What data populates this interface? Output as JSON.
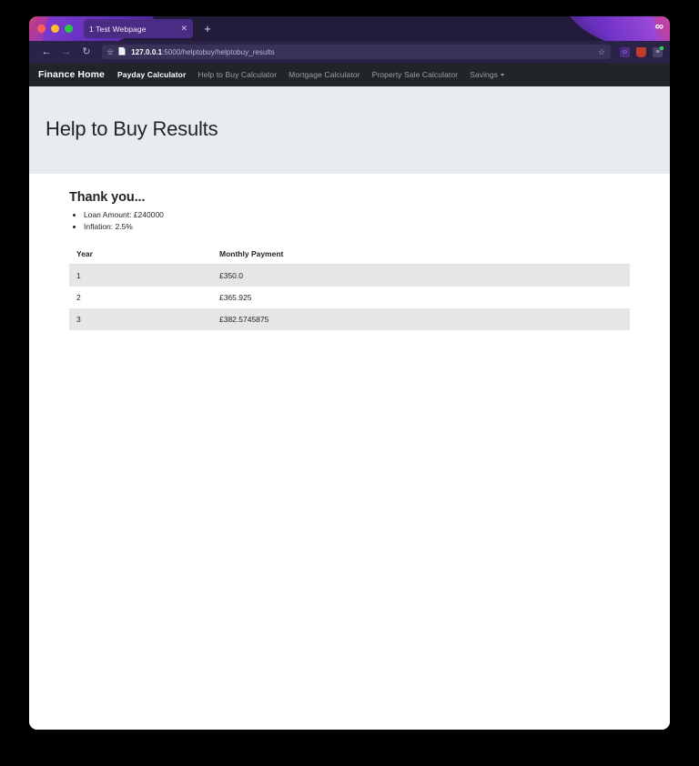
{
  "browser": {
    "traffic_lights": [
      "close",
      "minimize",
      "zoom"
    ],
    "tab": {
      "title": "1 Test Webpage",
      "close_icon": "close-icon"
    },
    "new_tab_label": "+",
    "account_icon": "goggles-icon",
    "back_icon": "←",
    "forward_icon": "→",
    "reload_icon": "↻",
    "url": {
      "shield_icon": "shield-icon",
      "page_icon": "page-icon",
      "host": "127.0.0.1",
      "path": ":5000/helptobuy/helptobuy_results",
      "bookmark_icon": "star-icon"
    },
    "extensions": [
      {
        "name": "face-extension-icon",
        "glyph": "◔"
      },
      {
        "name": "shield-extension-icon",
        "glyph": ""
      },
      {
        "name": "list-extension-icon",
        "glyph": "≡"
      }
    ]
  },
  "site_nav": {
    "brand": "Finance Home",
    "links": [
      {
        "label": "Payday Calculator",
        "current": true
      },
      {
        "label": "Help to Buy Calculator",
        "current": false
      },
      {
        "label": "Mortgage Calculator",
        "current": false
      },
      {
        "label": "Property Sale Calculator",
        "current": false
      }
    ],
    "dropdown": {
      "label": "Savings",
      "caret_icon": "chevron-down-icon"
    }
  },
  "jumbotron": {
    "title": "Help to Buy Results"
  },
  "main": {
    "heading": "Thank you...",
    "facts": [
      "Loan Amount: £240000",
      "Inflation: 2.5%"
    ],
    "table": {
      "headers": [
        "Year",
        "Monthly Payment"
      ],
      "rows": [
        [
          "1",
          "£350.0"
        ],
        [
          "2",
          "£365.925"
        ],
        [
          "3",
          "£382.5745875"
        ]
      ]
    }
  },
  "colors": {
    "chrome_purple": "#221b39",
    "toolbar_purple": "#2b2248",
    "site_nav_dark": "#212529",
    "jumbotron_grey": "#e9ecef",
    "stripe_grey": "#e6e6e6"
  }
}
